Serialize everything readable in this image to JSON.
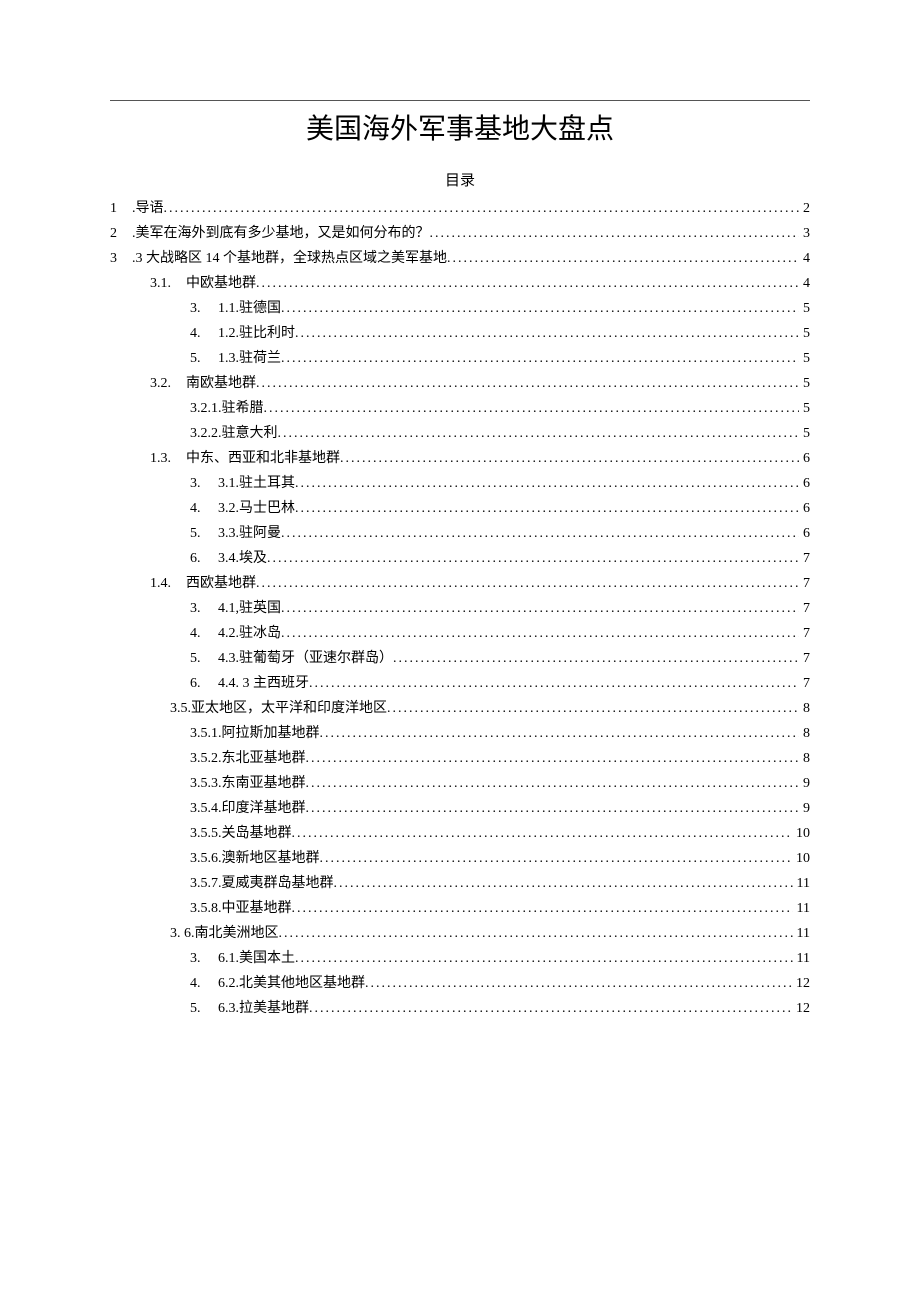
{
  "title": "美国海外军事基地大盘点",
  "toc_heading": "目录",
  "toc": [
    {
      "indent": "lvl1",
      "num": "1",
      "label": ".导语",
      "page": "2"
    },
    {
      "indent": "lvl1",
      "num": "2",
      "label": ".美军在海外到底有多少基地，又是如何分布的？ ",
      "page": "3"
    },
    {
      "indent": "lvl1",
      "num": "3",
      "label": ".3 大战略区 14 个基地群，全球热点区域之美军基地 ",
      "page": "4"
    },
    {
      "indent": "lvl2",
      "num": "3.1.",
      "label": "中欧基地群 ",
      "page": "4"
    },
    {
      "indent": "lvl3",
      "num": "3.",
      "label": "1.1.驻德国",
      "page": "5"
    },
    {
      "indent": "lvl3",
      "num": "4.",
      "label": "1.2.驻比利时",
      "page": "5"
    },
    {
      "indent": "lvl3",
      "num": "5.",
      "label": "1.3.驻荷兰",
      "page": "5"
    },
    {
      "indent": "lvl2",
      "num": "3.2.",
      "label": "南欧基地群 ",
      "page": "5"
    },
    {
      "indent": "lvl3b",
      "num": "",
      "label": "3.2.1.驻希腊",
      "page": "5"
    },
    {
      "indent": "lvl3b",
      "num": "",
      "label": "3.2.2.驻意大利",
      "page": "5"
    },
    {
      "indent": "lvl2",
      "num": "1.3.",
      "label": "中东、西亚和北非基地群 ",
      "page": "6"
    },
    {
      "indent": "lvl3",
      "num": "3.",
      "label": "3.1.驻土耳其",
      "page": "6"
    },
    {
      "indent": "lvl3",
      "num": "4.",
      "label": "3.2.马士巴林",
      "page": "6"
    },
    {
      "indent": "lvl3",
      "num": "5.",
      "label": "3.3.驻阿曼",
      "page": "6"
    },
    {
      "indent": "lvl3",
      "num": "6.",
      "label": "3.4.埃及",
      "page": "7"
    },
    {
      "indent": "lvl2",
      "num": "1.4.",
      "label": "西欧基地群 ",
      "page": "7"
    },
    {
      "indent": "lvl3",
      "num": "3.",
      "label": "4.1,驻英国",
      "page": "7"
    },
    {
      "indent": "lvl3",
      "num": "4.",
      "label": "4.2.驻冰岛",
      "page": "7"
    },
    {
      "indent": "lvl3",
      "num": "5.",
      "label": "4.3.驻葡萄牙（亚速尔群岛） ",
      "page": "7"
    },
    {
      "indent": "lvl3",
      "num": "6.",
      "label": "4.4.  3 主西班牙",
      "page": "7"
    },
    {
      "indent": "lvl3c",
      "num": "",
      "label": "3.5.亚太地区，太平洋和印度洋地区 ",
      "page": "8"
    },
    {
      "indent": "lvl3b",
      "num": "",
      "label": "3.5.1.阿拉斯加基地群",
      "page": "8"
    },
    {
      "indent": "lvl3b",
      "num": "",
      "label": "3.5.2.东北亚基地群",
      "page": "8"
    },
    {
      "indent": "lvl3b",
      "num": "",
      "label": "3.5.3.东南亚基地群",
      "page": "9"
    },
    {
      "indent": "lvl3b",
      "num": "",
      "label": "3.5.4.印度洋基地群",
      "page": "9"
    },
    {
      "indent": "lvl3b",
      "num": "",
      "label": "3.5.5.关岛基地群",
      "page": "10"
    },
    {
      "indent": "lvl3b",
      "num": "",
      "label": "3.5.6.澳新地区基地群",
      "page": "10"
    },
    {
      "indent": "lvl3b",
      "num": "",
      "label": "3.5.7.夏威夷群岛基地群",
      "page": "11"
    },
    {
      "indent": "lvl3b",
      "num": "",
      "label": "3.5.8.中亚基地群",
      "page": "11"
    },
    {
      "indent": "lvl3c",
      "num": "3.",
      "label": "  6.南北美洲地区 ",
      "page": "11"
    },
    {
      "indent": "lvl3",
      "num": "3.",
      "label": "6.1.美国本土",
      "page": "11"
    },
    {
      "indent": "lvl3",
      "num": "4.",
      "label": "6.2.北美其他地区基地群",
      "page": "12"
    },
    {
      "indent": "lvl3",
      "num": "5.",
      "label": "6.3.拉美基地群",
      "page": "12"
    }
  ]
}
